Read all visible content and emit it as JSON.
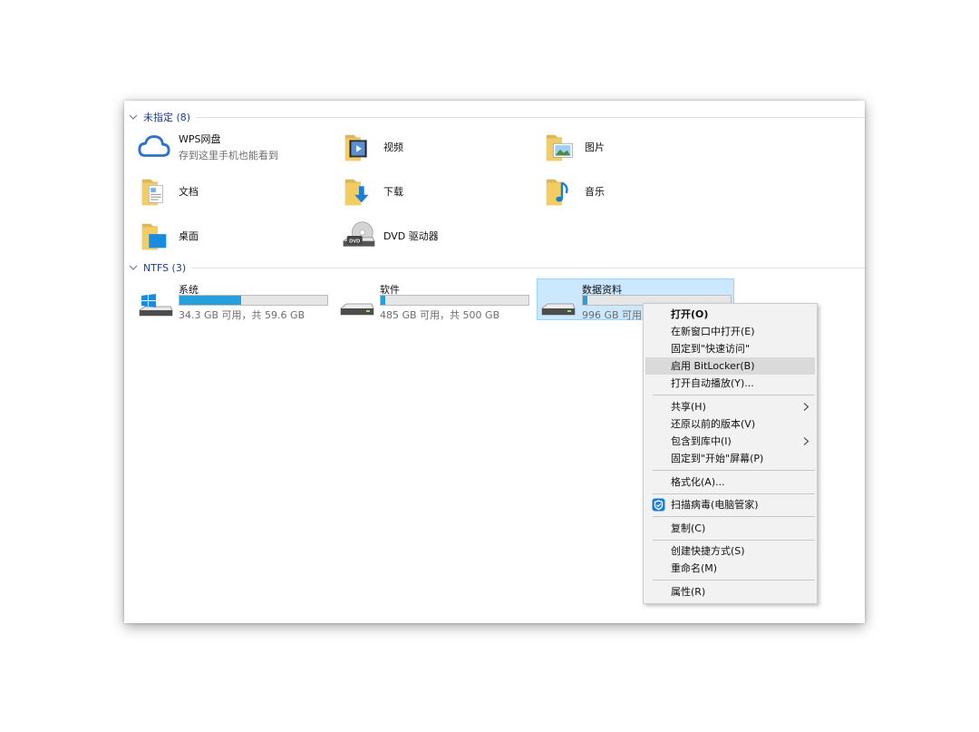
{
  "groups": {
    "unassigned": {
      "label": "未指定 (8)"
    },
    "ntfs": {
      "label": "NTFS (3)"
    }
  },
  "items": {
    "wps": {
      "name": "WPS网盘",
      "sub": "存到这里手机也能看到"
    },
    "video": {
      "name": "视频"
    },
    "pictures": {
      "name": "图片"
    },
    "documents": {
      "name": "文档"
    },
    "downloads": {
      "name": "下载"
    },
    "music": {
      "name": "音乐"
    },
    "desktop": {
      "name": "桌面"
    },
    "dvd": {
      "name": "DVD 驱动器"
    }
  },
  "drives": [
    {
      "name": "系统",
      "info": "34.3 GB 可用，共 59.6 GB",
      "used_percent": 42
    },
    {
      "name": "软件",
      "info": "485 GB 可用，共 500 GB",
      "used_percent": 3
    },
    {
      "name": "数据资料",
      "info": "996 GB 可用，",
      "used_percent": 3
    }
  ],
  "context_menu": {
    "open": "打开(O)",
    "open_new_window": "在新窗口中打开(E)",
    "pin_quick_access": "固定到\"快速访问\"",
    "enable_bitlocker": "启用 BitLocker(B)",
    "autoplay": "打开自动播放(Y)...",
    "share": "共享(H)",
    "restore_versions": "还原以前的版本(V)",
    "include_library": "包含到库中(I)",
    "pin_start": "固定到\"开始\"屏幕(P)",
    "format": "格式化(A)...",
    "scan_virus": "扫描病毒(电脑管家)",
    "copy": "复制(C)",
    "create_shortcut": "创建快捷方式(S)",
    "rename": "重命名(M)",
    "properties": "属性(R)"
  },
  "colors": {
    "accent": "#26a0da",
    "selection": "#cce8ff",
    "group_header": "#1e3d8f"
  }
}
